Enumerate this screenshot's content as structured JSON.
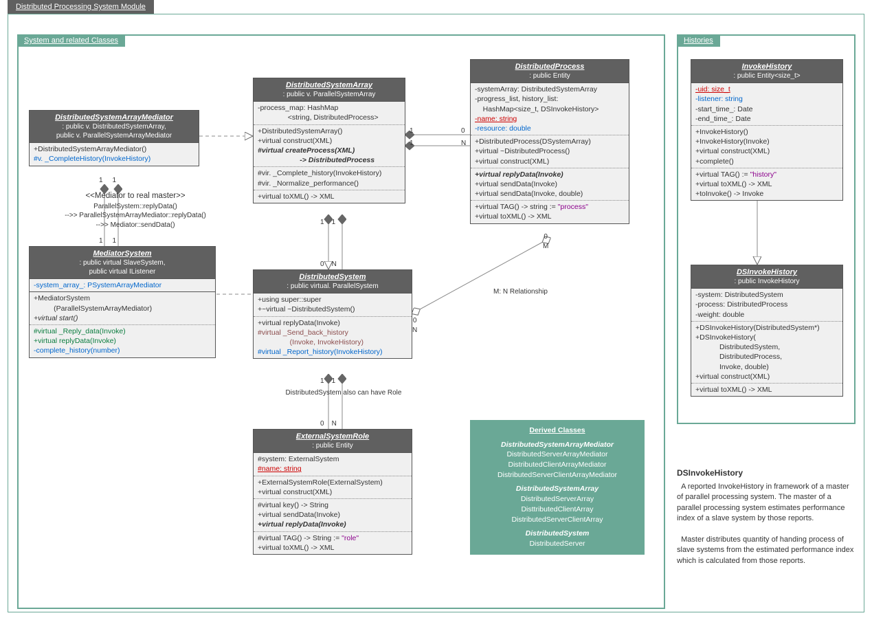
{
  "module_title": "Distributed Processing System Module",
  "groups": {
    "main": "System and related Classes",
    "hist": "Histories"
  },
  "mediator": {
    "title": "<<Mediator to real master>>",
    "l1": "ParallelSystem::replyData()",
    "l2": "-->> ParallelSystemArrayMediator::replyData()",
    "l3": "-->> Mediator::sendData()"
  },
  "rel_note": "DistributedSystem also can have Role",
  "mn_rel": "M: N Relationship",
  "c": {
    "dsam": {
      "title": "DistributedSystemArrayMediator",
      "sub": ": public v. DistributedSystemArray,\npublic v. ParallelSystemArrayMediator",
      "s1": "+DistributedSystemArrayMediator()\n#v. _CompleteHistory(InvokeHistory)"
    },
    "ms": {
      "title": "MediatorSystem",
      "sub": ": public virtual SlaveSystem,\npublic virtual IListener",
      "s1": "-system_array_: PSystemArrayMediator",
      "s2": "+MediatorSystem\n          (ParallelSystemArrayMediator)\n+virtual start()",
      "s3": "#virtual _Reply_data(Invoke)\n+virtual replyData(Invoke)\n-complete_history(number)"
    },
    "dsa": {
      "title": "DistributedSystemArray",
      "sub": ": public v. ParallelSystemArray",
      "s1": "-process_map: HashMap\n               <string, DistributedProcess>",
      "s2": "+DistributedSystemArray()\n+virtual construct(XML)\n#virtual createProcess(XML)\n                     -> DistributedProcess",
      "s3": "#vir. _Complete_history(InvokeHistory)\n#vir. _Normalize_performance()",
      "s4": "+virtual toXML() -> XML"
    },
    "ds": {
      "title": "DistributedSystem",
      "sub": ": public virtual. ParallelSystem",
      "s1": "+using super::super\n+~virtual ~DistributedSystem()",
      "s2": "+virtual replyData(Invoke)\n#virtual _Send_back_history\n                (Invoke, InvokeHistory)\n#virtual _Report_history(InvokeHistory)"
    },
    "esr": {
      "title": "ExternalSystemRole",
      "sub": ": public Entity",
      "s1": "#system: ExternalSystem\n#name: string",
      "s2": "+ExternalSystemRole(ExternalSystem)\n+virtual construct(XML)",
      "s3": "#virtual key() -> String\n+virtual sendData(Invoke)\n+virtual replyData(Invoke)",
      "s4": "#virtual TAG() -> String := \"role\"\n+virtual toXML() -> XML"
    },
    "dp": {
      "title": "DistributedProcess",
      "sub": ": public Entity",
      "s1": "-systemArray: DistributedSystemArray\n-progress_list, history_list:\n    HashMap<size_t, DSInvokeHistory>\n-name: string\n-resource: double",
      "s2": "+DistributedProcess(DSystemArray)\n+virtual ~DistributedProcess()\n+virtual construct(XML)",
      "s3": "+virtual replyData(Invoke)\n+virtual sendData(Invoke)\n+virtual sendData(Invoke, double)",
      "s4": "+virtual TAG() -> string := \"process\"\n+virtual toXML() -> XML"
    },
    "ih": {
      "title": "InvokeHistory",
      "sub": ": public Entity<size_t>",
      "s1": "-uid: size_t\n-listener: string\n-start_time_: Date\n-end_time_: Date",
      "s2": "+InvokeHistory()\n+InvokeHistory(Invoke)\n+virtual construct(XML)\n+complete()",
      "s3": "+virtual TAG() := \"history\"\n+virtual toXML() -> XML\n+toInvoke() -> Invoke"
    },
    "dih": {
      "title": "DSInvokeHistory",
      "sub": ": public InvokeHistory",
      "s1": "-system: DistributedSystem\n-process: DistributedProcess\n-weight: double",
      "s2": "+DSInvokeHistory(DistributedSystem*)\n+DSInvokeHistory(\n            DistributedSystem,\n            DistributedProcess,\n            Invoke, double)\n+virtual construct(XML)",
      "s3": "+virtual toXML() -> XML"
    }
  },
  "derived": {
    "hd": "Derived Classes",
    "g1": "DistributedSystemArrayMediator",
    "g1l": "DistributedServerArrayMediator\nDistributedClientArrayMediator\nDistributedServerClientArrayMediator",
    "g2": "DistributedSystemArray",
    "g2l": "DistributedServerArray\nDisttributedClientArray\nDistributedServerClientArray",
    "g3": "DistributedSystem",
    "g3l": "DistributedServer"
  },
  "desc": {
    "hd": "DSInvokeHistory",
    "p1": "  A reported InvokeHistory in framework of a master of parallel processing system. The master of a parallel processing system estimates performance index of a slave system by those reports.",
    "p2": "  Master distributes quantity of handing process of slave systems from the estimated performance index which is calculated from those reports."
  }
}
